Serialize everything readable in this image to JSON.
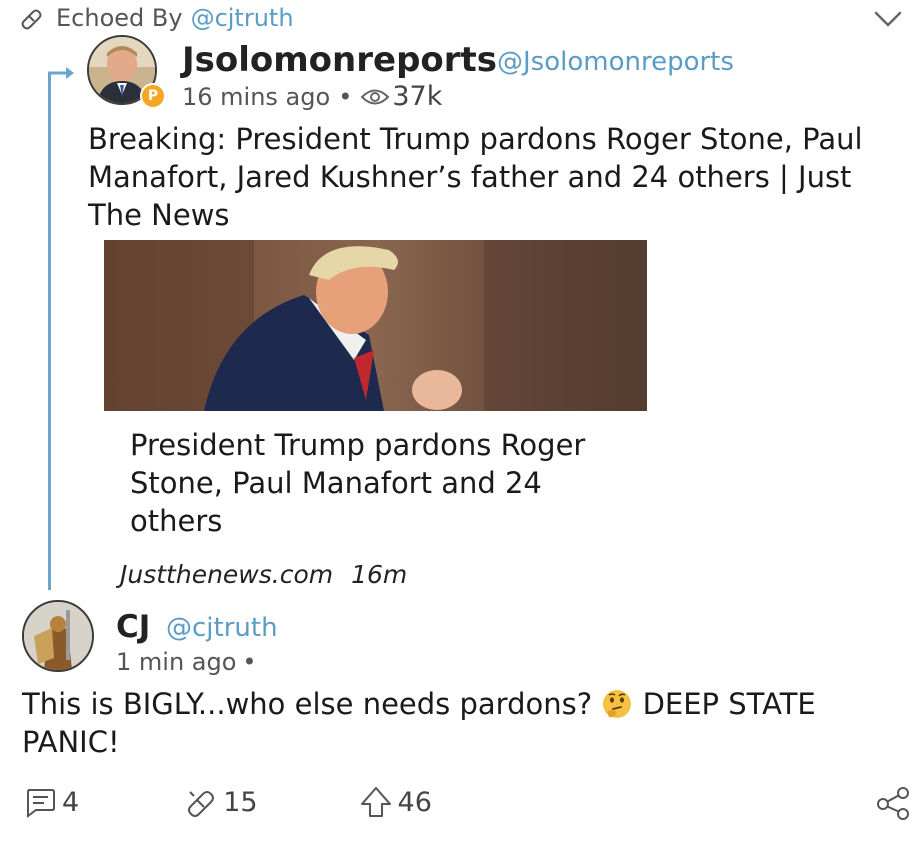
{
  "echo": {
    "label": "Echoed By",
    "handle": "@cjtruth",
    "icon": "echo-icon"
  },
  "original_post": {
    "author": "Jsolomonreports",
    "handle": "@Jsolomonreports",
    "time": "16 mins ago",
    "separator": "•",
    "views": "37k",
    "badge": "P",
    "text": "Breaking: President Trump pardons Roger Stone, Paul Manafort, Jared Kushner’s father and 24 others | Just The News",
    "link_card": {
      "title": "President Trump pardons Roger Stone, Paul Manafort and 24 others",
      "source": "Justthenews.com",
      "age": "16m"
    }
  },
  "reply_post": {
    "author": "CJ",
    "handle": "@cjtruth",
    "time": "1 min ago",
    "separator": "•",
    "text_before_emoji": "This is BIGLY...who else needs pardons? ",
    "emoji": "thinking-face",
    "text_after_emoji": " DEEP STATE PANIC!",
    "actions": {
      "comments": "4",
      "echoes": "15",
      "upvotes": "46"
    }
  },
  "colors": {
    "accent": "#5a9cc6",
    "thread": "#6aa6cc",
    "badge": "#f5a623"
  }
}
